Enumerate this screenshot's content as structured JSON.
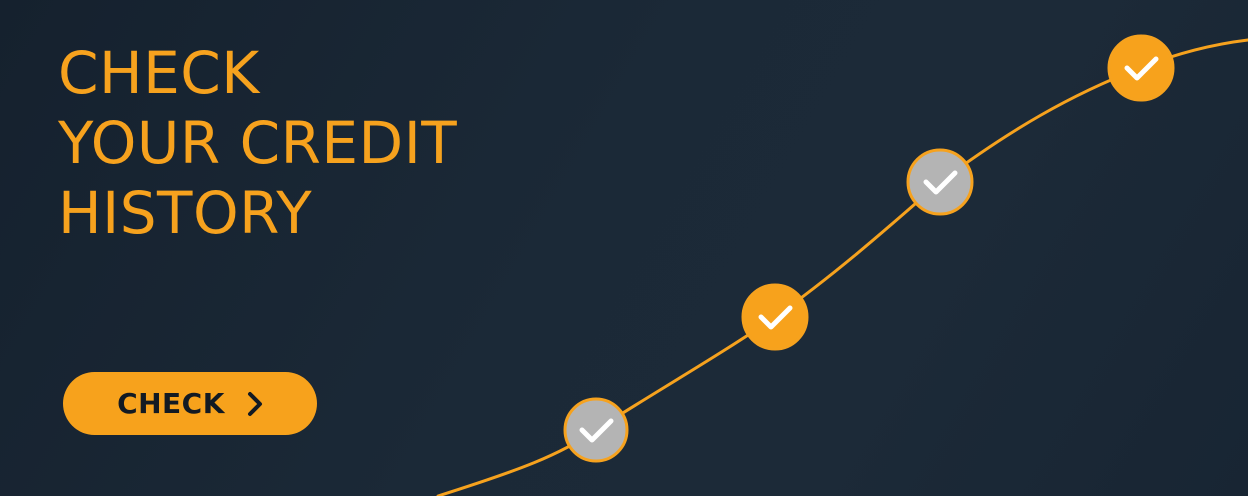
{
  "headline": {
    "line1": "CHECK",
    "line2": "YOUR CREDIT",
    "line3": "HISTORY"
  },
  "cta": {
    "label": "CHECK",
    "icon": "chevron-right-icon"
  },
  "progress_path": {
    "steps": [
      {
        "state": "inactive",
        "icon": "check-icon"
      },
      {
        "state": "active",
        "icon": "check-icon"
      },
      {
        "state": "inactive",
        "icon": "check-icon"
      },
      {
        "state": "active",
        "icon": "check-icon"
      }
    ]
  },
  "colors": {
    "background": "#1b2937",
    "accent": "#f6a21e",
    "inactive": "#b4b4b4",
    "check_mark": "#ffffff",
    "button_text": "#121a23"
  }
}
